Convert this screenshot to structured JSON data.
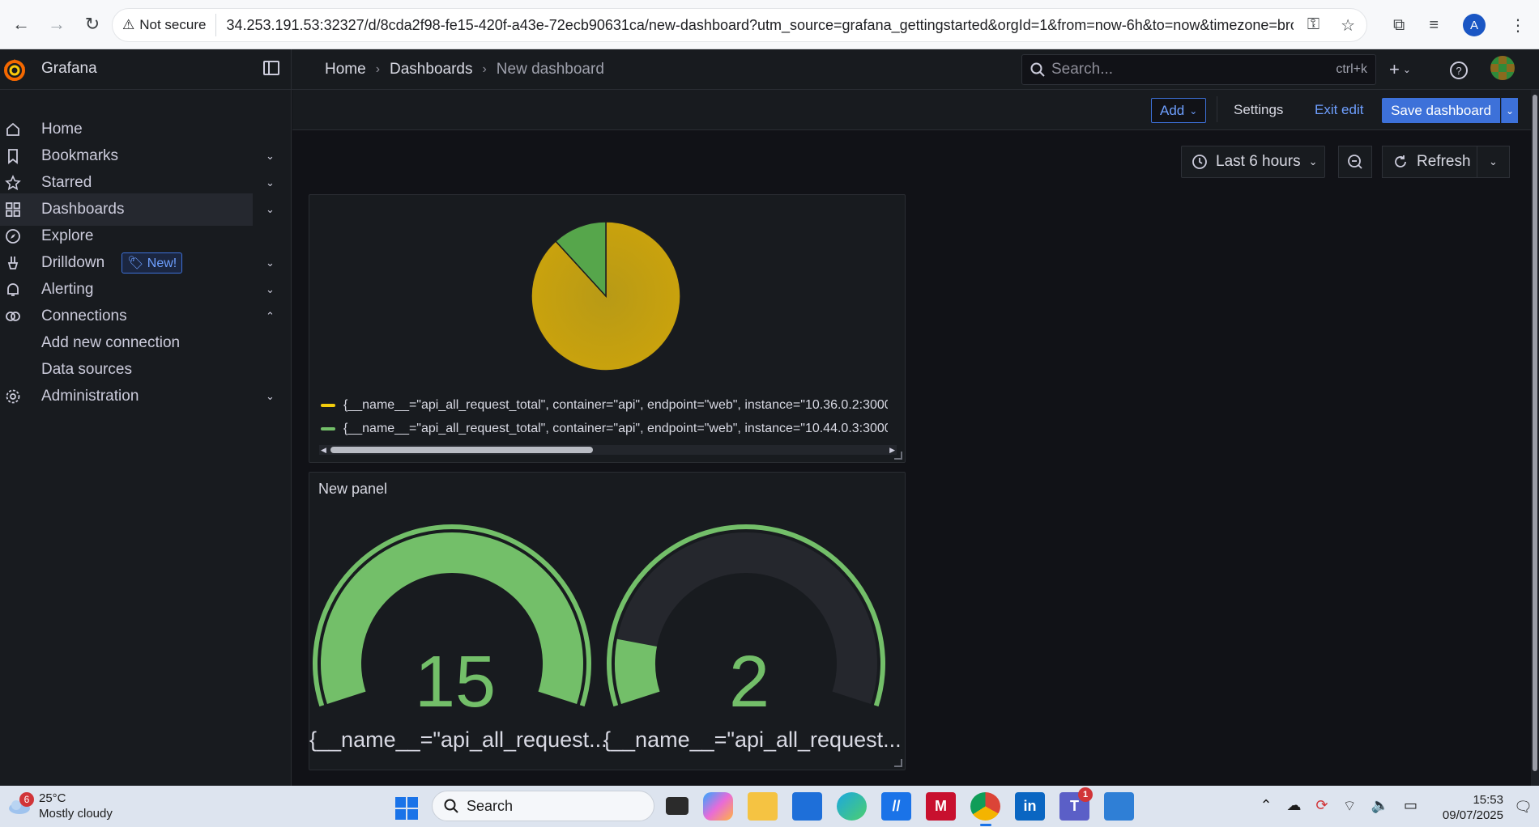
{
  "browser": {
    "security_label": "Not secure",
    "url": "34.253.191.53:32327/d/8cda2f98-fe15-420f-a43e-72ecb90631ca/new-dashboard?utm_source=grafana_gettingstarted&orgId=1&from=now-6h&to=now&timezone=bro...",
    "profile_initial": "A"
  },
  "app": {
    "brand": "Grafana",
    "breadcrumb": [
      "Home",
      "Dashboards",
      "New dashboard"
    ],
    "search_placeholder": "Search...",
    "search_shortcut": "ctrl+k"
  },
  "sidebar": {
    "items": [
      {
        "label": "Home",
        "icon": "home-icon",
        "expandable": false
      },
      {
        "label": "Bookmarks",
        "icon": "bookmark-icon",
        "expandable": true
      },
      {
        "label": "Starred",
        "icon": "star-icon",
        "expandable": true
      },
      {
        "label": "Dashboards",
        "icon": "apps-icon",
        "expandable": true,
        "active": true
      },
      {
        "label": "Explore",
        "icon": "compass-icon",
        "expandable": false
      },
      {
        "label": "Drilldown",
        "icon": "drilldown-icon",
        "expandable": true,
        "badge": "New!"
      },
      {
        "label": "Alerting",
        "icon": "bell-icon",
        "expandable": true
      },
      {
        "label": "Connections",
        "icon": "link-icon",
        "expandable": true,
        "expanded": true
      },
      {
        "label": "Add new connection",
        "child": true
      },
      {
        "label": "Data sources",
        "child": true
      },
      {
        "label": "Administration",
        "icon": "cog-icon",
        "expandable": true
      }
    ]
  },
  "editbar": {
    "add_label": "Add",
    "settings_label": "Settings",
    "exit_label": "Exit edit",
    "save_label": "Save dashboard"
  },
  "time_controls": {
    "range_label": "Last 6 hours",
    "refresh_label": "Refresh"
  },
  "pie_panel": {
    "legend": [
      {
        "text": "{__name__=\"api_all_request_total\", container=\"api\", endpoint=\"web\", instance=\"10.36.0.2:3000",
        "color": "#f2cc0c"
      },
      {
        "text": "{__name__=\"api_all_request_total\", container=\"api\", endpoint=\"web\", instance=\"10.44.0.3:3000",
        "color": "#73bf69"
      }
    ],
    "slice_values": [
      15,
      2
    ],
    "slice_colors": [
      "#c9a20d",
      "#56a64b"
    ]
  },
  "gauge_panel": {
    "title": "New panel",
    "gauges": [
      {
        "value": "15",
        "label": "{__name__=\"api_all_request...",
        "fill": 1.0
      },
      {
        "value": "2",
        "label": "{__name__=\"api_all_request...",
        "fill": 0.1333
      }
    ],
    "color": "#73bf69"
  },
  "taskbar": {
    "weather_temp": "25°C",
    "weather_desc": "Mostly cloudy",
    "weather_badge": "6",
    "search_placeholder": "Search",
    "teams_badge": "1",
    "time": "15:53",
    "date": "09/07/2025"
  }
}
